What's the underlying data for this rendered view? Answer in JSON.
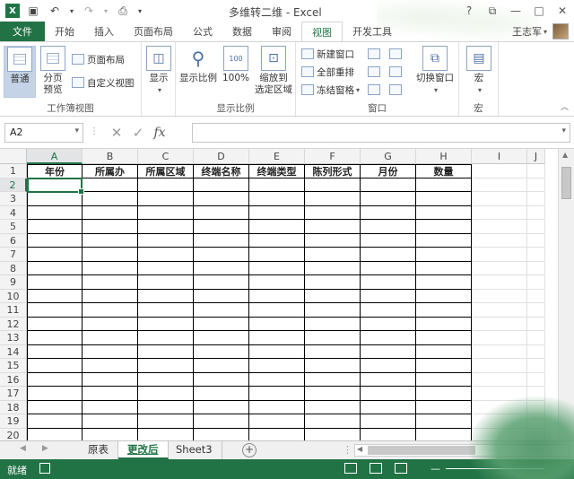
{
  "window": {
    "title": "多维转二维 - Excel",
    "controls": {
      "help": "?",
      "restore": "⧉",
      "minimize": "—",
      "maximize": "□",
      "close": "✕"
    }
  },
  "qat": {
    "save_icon": "save-icon",
    "undo_icon": "undo-icon",
    "redo_icon": "redo-icon",
    "preview_icon": "print-preview-icon"
  },
  "tabs": [
    {
      "label": "文件"
    },
    {
      "label": "开始"
    },
    {
      "label": "插入"
    },
    {
      "label": "页面布局"
    },
    {
      "label": "公式"
    },
    {
      "label": "数据"
    },
    {
      "label": "审阅"
    },
    {
      "label": "视图"
    },
    {
      "label": "开发工具"
    }
  ],
  "active_tab": "视图",
  "user": {
    "name": "王志军"
  },
  "ribbon": {
    "workbook_views": {
      "label": "工作簿视图",
      "normal": "普通",
      "page_break": "分页\n预览",
      "page_layout": "页面布局",
      "custom_views": "自定义视图"
    },
    "show": {
      "label": "显示"
    },
    "zoom": {
      "label": "显示比例",
      "zoom_btn": "显示比例",
      "hundred": "100%",
      "zoom_selection": "缩放到\n选定区域"
    },
    "window": {
      "label": "窗口",
      "new_window": "新建窗口",
      "arrange_all": "全部重排",
      "freeze_panes": "冻结窗格",
      "switch_windows": "切换窗口"
    },
    "macros": {
      "label": "宏",
      "macros_btn": "宏"
    }
  },
  "formula_bar": {
    "name_box": "A2",
    "formula": ""
  },
  "sheet": {
    "columns": [
      "A",
      "B",
      "C",
      "D",
      "E",
      "F",
      "G",
      "H",
      "I",
      "J"
    ],
    "active_column": "A",
    "active_row": "2",
    "rows": [
      "1",
      "2",
      "3",
      "4",
      "5",
      "6",
      "7",
      "8",
      "9",
      "10",
      "11",
      "12",
      "13",
      "14",
      "15",
      "16",
      "17",
      "18",
      "19",
      "20"
    ],
    "header_row": [
      "年份",
      "所属办",
      "所属区域",
      "终端名称",
      "终端类型",
      "陈列形式",
      "月份",
      "数量"
    ]
  },
  "sheet_tabs": [
    {
      "label": "原表"
    },
    {
      "label": "更改后"
    },
    {
      "label": "Sheet3"
    }
  ],
  "active_sheet": "更改后",
  "status": {
    "text": "就绪"
  }
}
